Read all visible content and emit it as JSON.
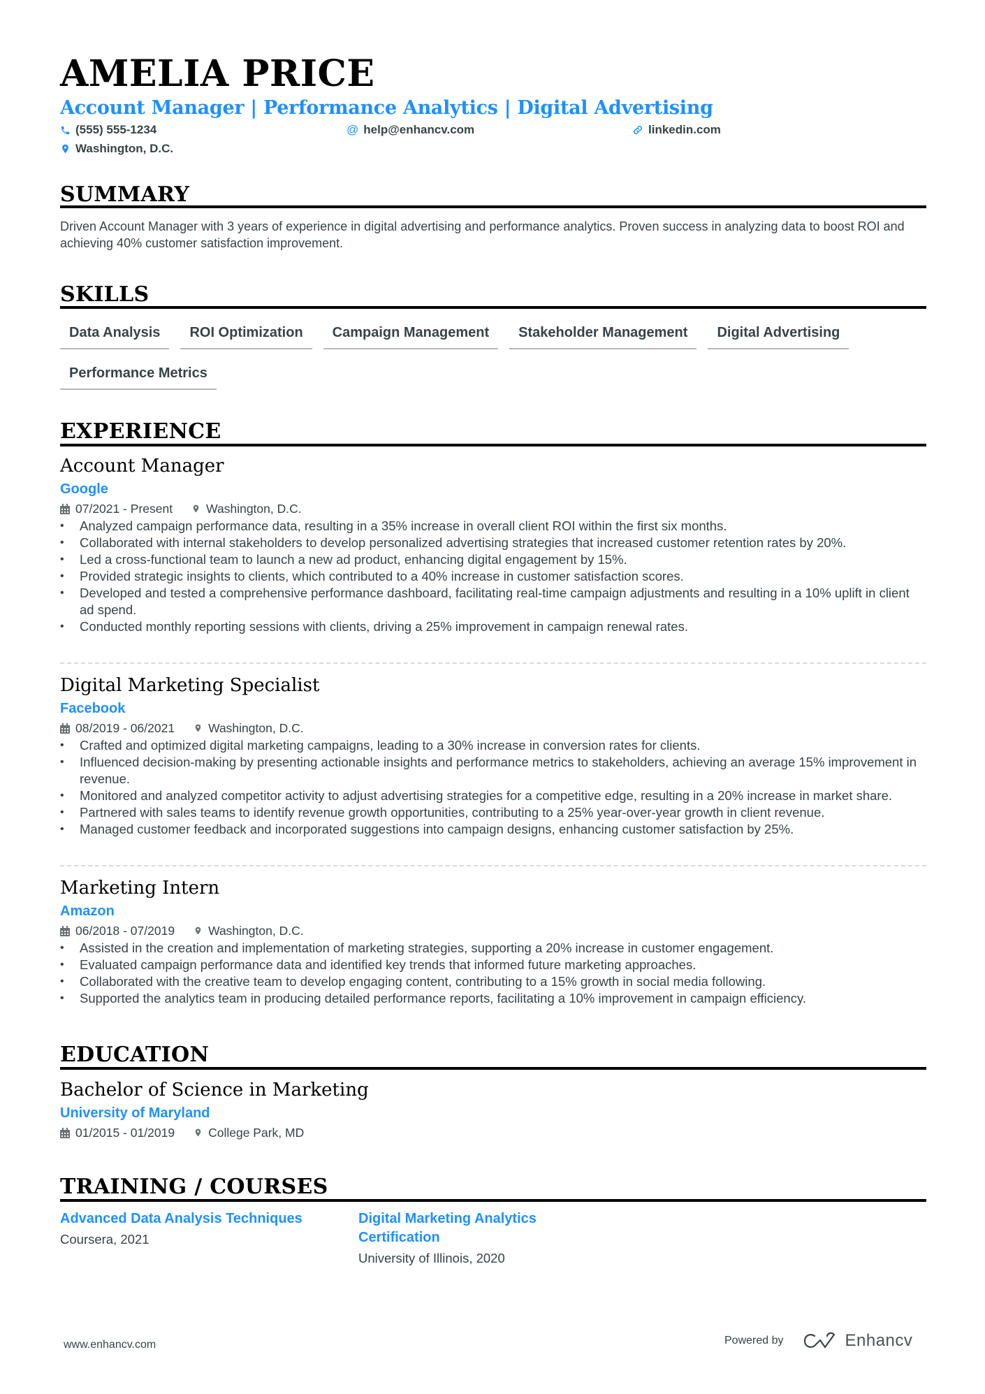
{
  "header": {
    "name": "AMELIA PRICE",
    "headline": "Account Manager | Performance Analytics | Digital Advertising",
    "phone": "(555) 555-1234",
    "email": "help@enhancv.com",
    "linkedin": "linkedin.com",
    "location": "Washington, D.C."
  },
  "colors": {
    "accent": "#1e90ff",
    "text": "#384347",
    "heading": "#000000"
  },
  "summary": {
    "title": "SUMMARY",
    "text": "Driven Account Manager with 3 years of experience in digital advertising and performance analytics. Proven success in analyzing data to boost ROI and achieving 40% customer satisfaction improvement."
  },
  "skills": {
    "title": "SKILLS",
    "items": [
      "Data Analysis",
      "ROI Optimization",
      "Campaign Management",
      "Stakeholder Management",
      "Digital Advertising",
      "Performance Metrics"
    ]
  },
  "experience": {
    "title": "EXPERIENCE",
    "jobs": [
      {
        "title": "Account Manager",
        "company": "Google",
        "dates": "07/2021 - Present",
        "location": "Washington, D.C.",
        "bullets": [
          "Analyzed campaign performance data, resulting in a 35% increase in overall client ROI within the first six months.",
          "Collaborated with internal stakeholders to develop personalized advertising strategies that increased customer retention rates by 20%.",
          "Led a cross-functional team to launch a new ad product, enhancing digital engagement by 15%.",
          "Provided strategic insights to clients, which contributed to a 40% increase in customer satisfaction scores.",
          "Developed and tested a comprehensive performance dashboard, facilitating real-time campaign adjustments and resulting in a 10% uplift in client ad spend.",
          "Conducted monthly reporting sessions with clients, driving a 25% improvement in campaign renewal rates."
        ]
      },
      {
        "title": "Digital Marketing Specialist",
        "company": "Facebook",
        "dates": "08/2019 - 06/2021",
        "location": "Washington, D.C.",
        "bullets": [
          "Crafted and optimized digital marketing campaigns, leading to a 30% increase in conversion rates for clients.",
          "Influenced decision-making by presenting actionable insights and performance metrics to stakeholders, achieving an average 15% improvement in revenue.",
          "Monitored and analyzed competitor activity to adjust advertising strategies for a competitive edge, resulting in a 20% increase in market share.",
          "Partnered with sales teams to identify revenue growth opportunities, contributing to a 25% year-over-year growth in client revenue.",
          "Managed customer feedback and incorporated suggestions into campaign designs, enhancing customer satisfaction by 25%."
        ]
      },
      {
        "title": "Marketing Intern",
        "company": "Amazon",
        "dates": "06/2018 - 07/2019",
        "location": "Washington, D.C.",
        "bullets": [
          "Assisted in the creation and implementation of marketing strategies, supporting a 20% increase in customer engagement.",
          "Evaluated campaign performance data and identified key trends that informed future marketing approaches.",
          "Collaborated with the creative team to develop engaging content, contributing to a 15% growth in social media following.",
          "Supported the analytics team in producing detailed performance reports, facilitating a 10% improvement in campaign efficiency."
        ]
      }
    ]
  },
  "education": {
    "title": "EDUCATION",
    "degree": "Bachelor of Science in Marketing",
    "school": "University of Maryland",
    "dates": "01/2015 - 01/2019",
    "location": "College Park, MD"
  },
  "training": {
    "title": "TRAINING / COURSES",
    "courses": [
      {
        "title": "Advanced Data Analysis Techniques",
        "sub": "Coursera, 2021"
      },
      {
        "title": "Digital Marketing Analytics Certification",
        "sub": "University of Illinois, 2020"
      }
    ]
  },
  "footer": {
    "website": "www.enhancv.com",
    "powered_by": "Powered by",
    "brand": "Enhancv"
  }
}
